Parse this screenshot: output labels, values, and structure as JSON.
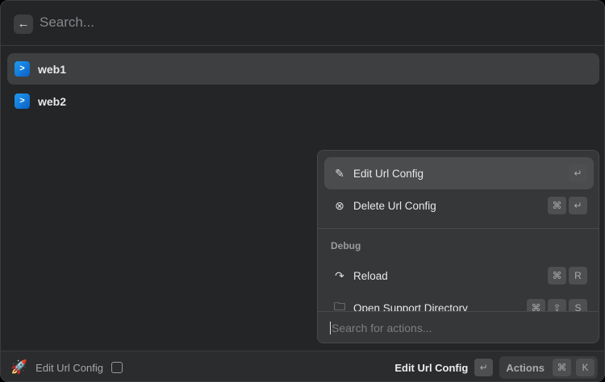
{
  "search": {
    "placeholder": "Search..."
  },
  "list": [
    {
      "label": "web1"
    },
    {
      "label": "web2"
    }
  ],
  "actions": {
    "items": [
      {
        "label": "Edit Url Config",
        "keys": [
          "↵"
        ]
      },
      {
        "label": "Delete Url Config",
        "keys": [
          "⌘",
          "↵"
        ]
      }
    ],
    "section": "Debug",
    "debug_items": [
      {
        "label": "Reload",
        "keys": [
          "⌘",
          "R"
        ]
      },
      {
        "label": "Open Support Directory",
        "keys": [
          "⌘",
          "⇧",
          "S"
        ]
      }
    ],
    "search_placeholder": "Search for actions..."
  },
  "footer": {
    "title": "Edit Url Config",
    "primary_action": "Edit Url Config",
    "enter_key": "↵",
    "actions_label": "Actions",
    "actions_keys": [
      "⌘",
      "K"
    ]
  }
}
